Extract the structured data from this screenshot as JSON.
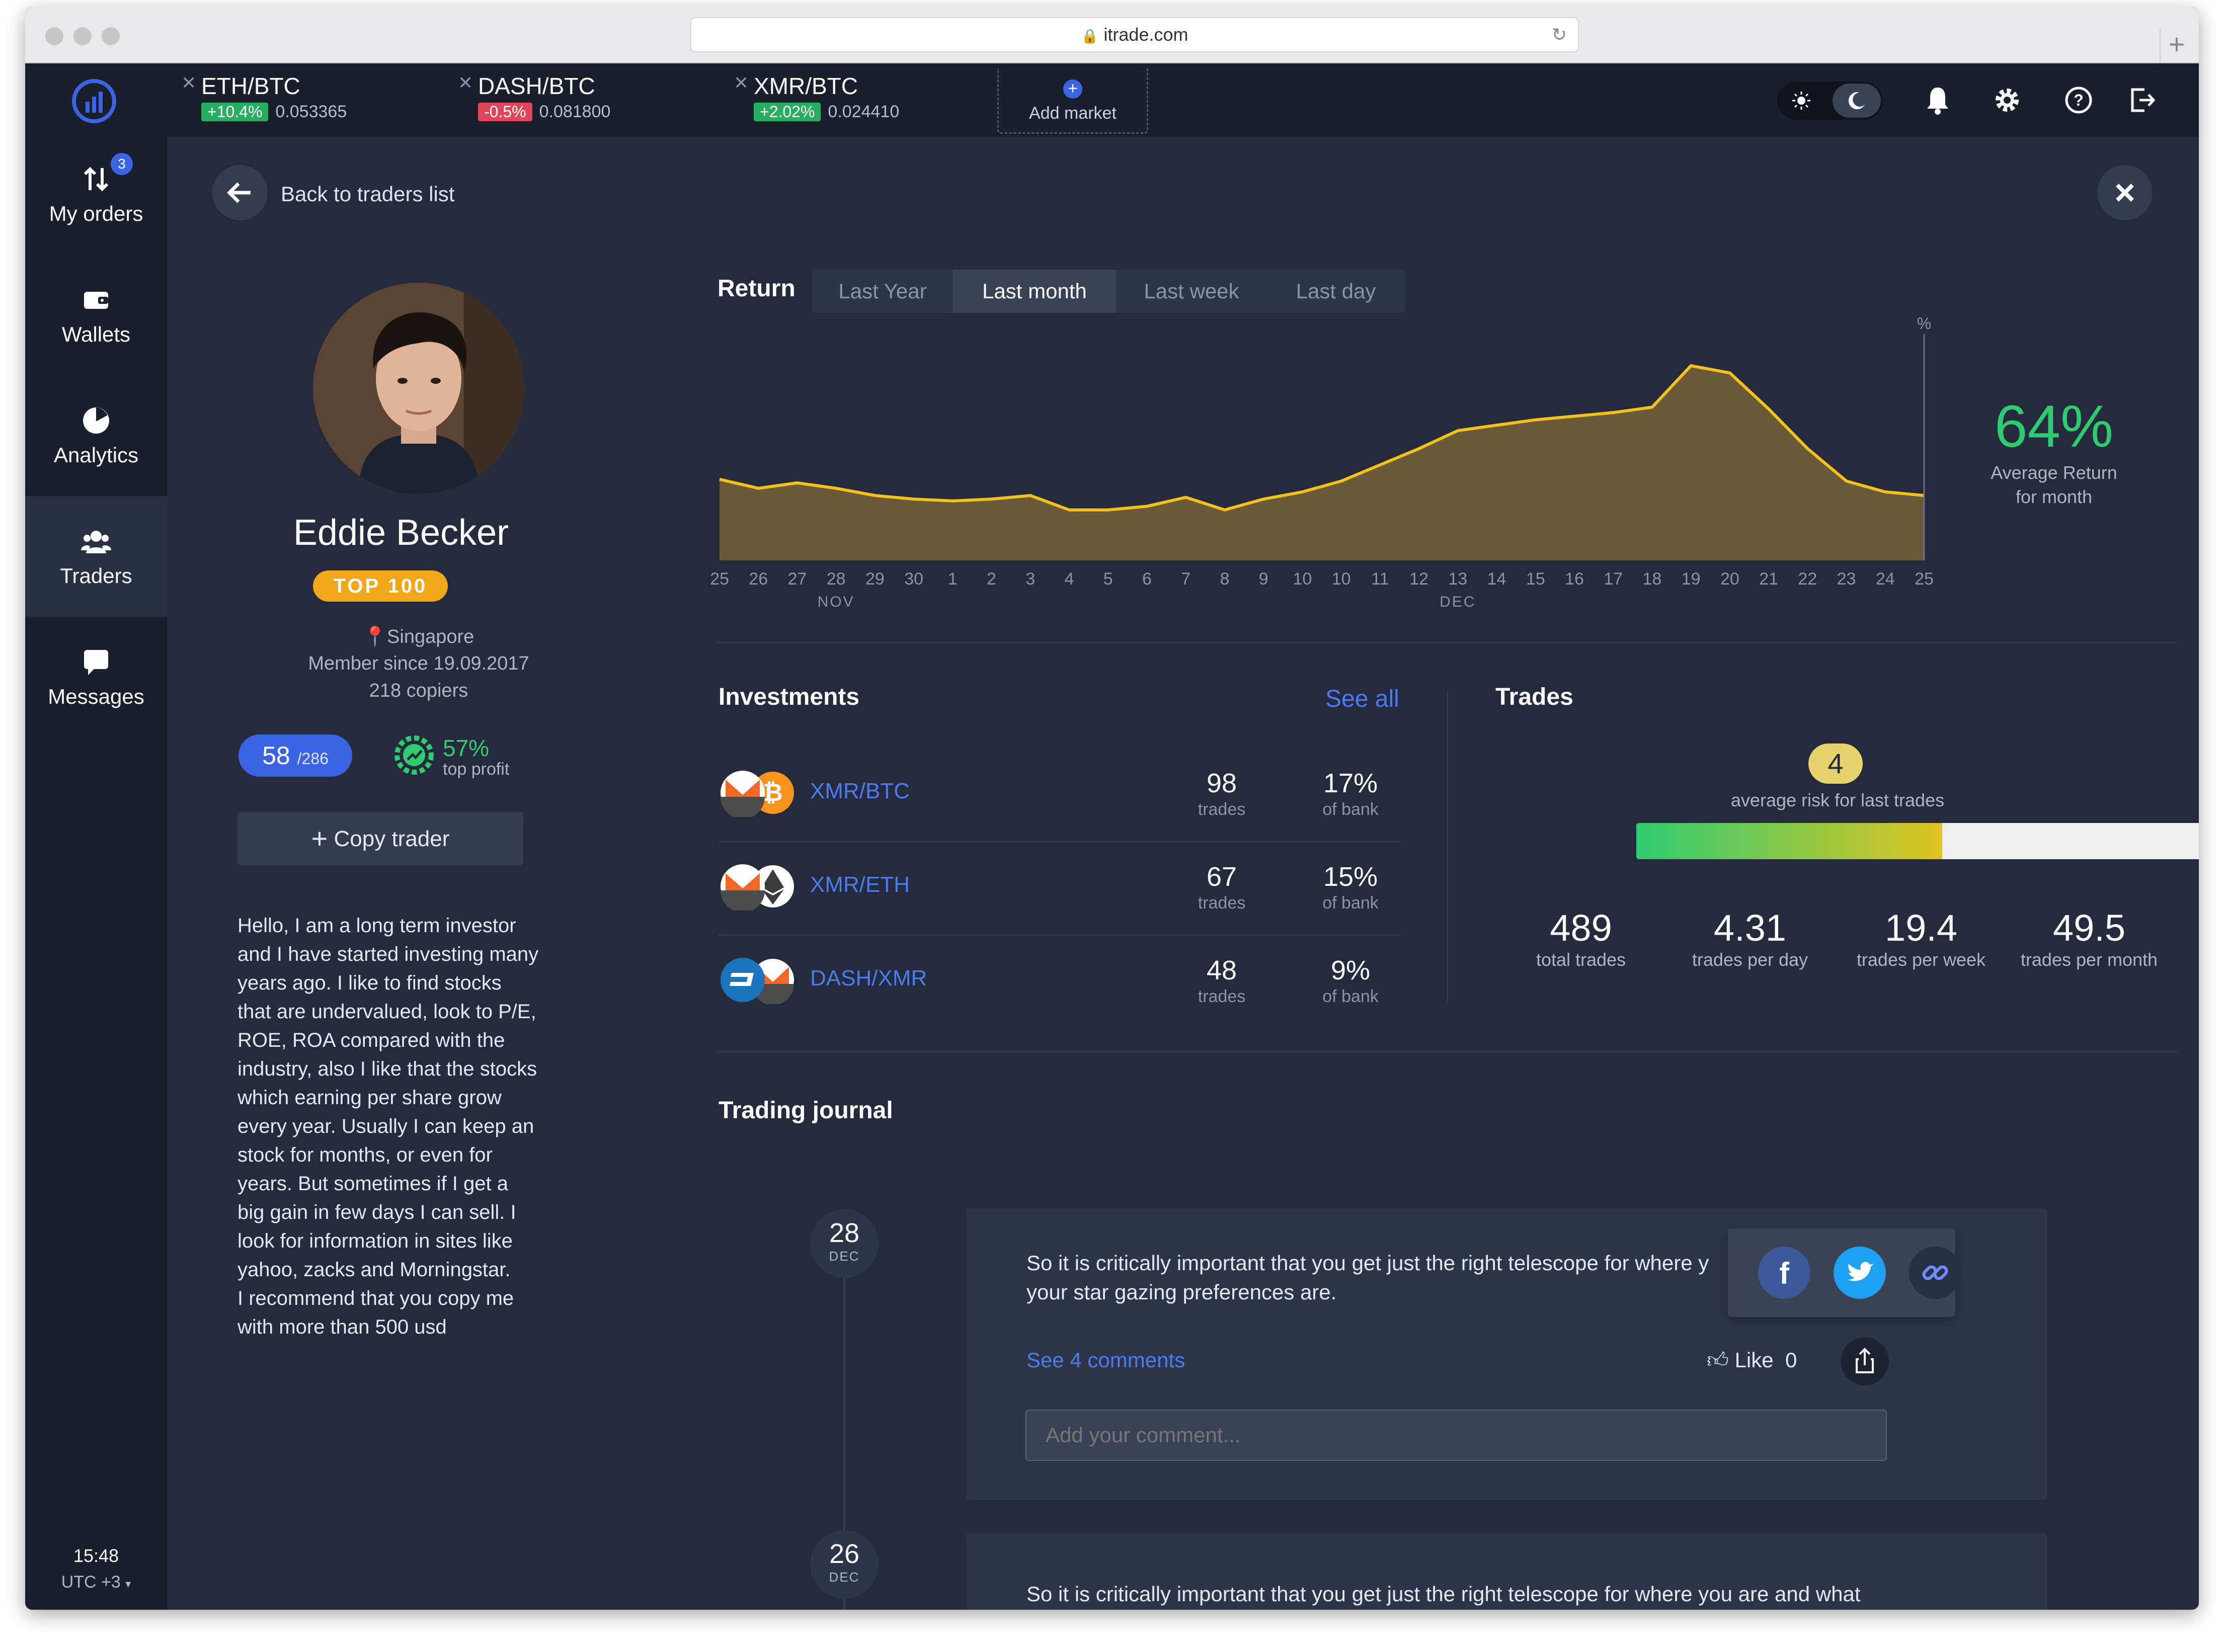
{
  "browser": {
    "url": "itrade.com"
  },
  "tickers": [
    {
      "pair": "ETH/BTC",
      "change": "+10.4%",
      "price": "0.053365",
      "color": "#27ae60"
    },
    {
      "pair": "DASH/BTC",
      "change": "-0.5%",
      "price": "0.081800",
      "color": "#e0455a"
    },
    {
      "pair": "XMR/BTC",
      "change": "+2.02%",
      "price": "0.024410",
      "color": "#27ae60"
    }
  ],
  "add_market": "Add market",
  "sidebar": {
    "items": [
      {
        "label": "My orders",
        "icon": "arrows-icon",
        "badge": "3"
      },
      {
        "label": "Wallets",
        "icon": "wallet-icon"
      },
      {
        "label": "Analytics",
        "icon": "pie-chart-icon"
      },
      {
        "label": "Traders",
        "icon": "users-icon"
      },
      {
        "label": "Messages",
        "icon": "chat-icon"
      }
    ],
    "time": "15:48",
    "timezone": "UTC +3"
  },
  "back_label": "Back to traders list",
  "profile": {
    "name": "Eddie Becker",
    "badge": "TOP 100",
    "location": "Singapore",
    "member_since": "Member since 19.09.2017",
    "copiers": "218 copiers",
    "rank": "58",
    "rank_total": "/286",
    "profit": "57%",
    "profit_label": "top profit",
    "copy_button": "Copy trader",
    "bio": "Hello, I am a long term investor and I have started investing many years ago. I like to find stocks that are undervalued,  look to P/E, ROE, ROA compared with the industry, also I like that the stocks which earning per share grow every year. Usually I can keep an stock for months, or even for years. But sometimes if I get a big gain in few days I can sell.  I look for information in sites like yahoo, zacks and Morningstar.\nI recommend that you copy me with more than 500 usd"
  },
  "return_section": {
    "title": "Return",
    "tabs": [
      "Last Year",
      "Last month",
      "Last week",
      "Last day"
    ],
    "active_tab": "Last month",
    "avg_return": "64%",
    "avg_label_1": "Average Return",
    "avg_label_2": "for month"
  },
  "chart_data": {
    "type": "area",
    "title": "Return",
    "x": [
      "25",
      "26",
      "27",
      "28",
      "29",
      "30",
      "1",
      "2",
      "3",
      "4",
      "5",
      "6",
      "7",
      "8",
      "9",
      "10",
      "10",
      "11",
      "12",
      "13",
      "14",
      "15",
      "16",
      "17",
      "18",
      "19",
      "20",
      "21",
      "22",
      "23",
      "24",
      "25"
    ],
    "month_labels": [
      "NOV",
      "DEC"
    ],
    "ylabel": "%",
    "values": [
      45,
      40,
      43,
      40,
      36,
      34,
      33,
      34,
      36,
      28,
      28,
      30,
      35,
      28,
      34,
      38,
      44,
      53,
      62,
      72,
      75,
      78,
      80,
      82,
      85,
      108,
      104,
      84,
      62,
      44,
      38,
      36
    ],
    "ylim": [
      0,
      120
    ],
    "grid": false,
    "colors": {
      "line": "#f2c11b",
      "fill": "#6a5a3a"
    }
  },
  "investments": {
    "title": "Investments",
    "see_all": "See all",
    "rows": [
      {
        "pair": "XMR/BTC",
        "trades": "98",
        "trades_label": "trades",
        "bank": "17%",
        "bank_label": "of bank",
        "icon": "monero-bitcoin-icon"
      },
      {
        "pair": "XMR/ETH",
        "trades": "67",
        "trades_label": "trades",
        "bank": "15%",
        "bank_label": "of bank",
        "icon": "monero-ethereum-icon"
      },
      {
        "pair": "DASH/XMR",
        "trades": "48",
        "trades_label": "trades",
        "bank": "9%",
        "bank_label": "of bank",
        "icon": "dash-monero-icon"
      }
    ]
  },
  "trades": {
    "title": "Trades",
    "risk": "4",
    "risk_label": "average risk for last trades",
    "risk_level": 0.45,
    "stats": [
      {
        "value": "489",
        "label": "total trades"
      },
      {
        "value": "4.31",
        "label": "trades per day"
      },
      {
        "value": "19.4",
        "label": "trades per week"
      },
      {
        "value": "49.5",
        "label": "trades per month"
      }
    ]
  },
  "journal": {
    "title": "Trading journal",
    "posts": [
      {
        "day": "28",
        "month": "DEC",
        "text": "So it is critically important that you get just the right telescope for where y",
        "text2": "your star gazing preferences are.",
        "comments": "See 4 comments",
        "like": "Like",
        "likes": "0",
        "placeholder": "Add your comment..."
      },
      {
        "day": "26",
        "month": "DEC",
        "text": "So it is critically important that you get just the right telescope for where you are and what"
      }
    ]
  }
}
